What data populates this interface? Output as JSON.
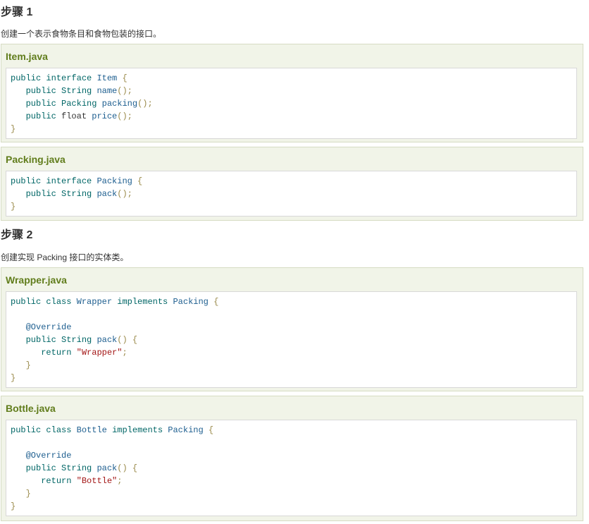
{
  "step1": {
    "title": "步骤 1",
    "desc": "创建一个表示食物条目和食物包装的接口。"
  },
  "step2": {
    "title": "步骤 2",
    "desc": "创建实现 Packing 接口的实体类。"
  },
  "files": [
    {
      "name": "Item.java",
      "lines": [
        [
          [
            "kw",
            "public "
          ],
          [
            "kw",
            "interface "
          ],
          [
            "id",
            "Item "
          ],
          [
            "pu",
            "{"
          ]
        ],
        [
          [
            "pl",
            "   "
          ],
          [
            "kw",
            "public "
          ],
          [
            "kw",
            "String "
          ],
          [
            "id",
            "name"
          ],
          [
            "pu",
            "();"
          ]
        ],
        [
          [
            "pl",
            "   "
          ],
          [
            "kw",
            "public "
          ],
          [
            "kw",
            "Packing "
          ],
          [
            "id",
            "packing"
          ],
          [
            "pu",
            "();"
          ]
        ],
        [
          [
            "pl",
            "   "
          ],
          [
            "kw",
            "public "
          ],
          [
            "pl",
            "float "
          ],
          [
            "id",
            "price"
          ],
          [
            "pu",
            "();"
          ]
        ],
        [
          [
            "pu",
            "}"
          ]
        ]
      ]
    },
    {
      "name": "Packing.java",
      "lines": [
        [
          [
            "kw",
            "public "
          ],
          [
            "kw",
            "interface "
          ],
          [
            "id",
            "Packing "
          ],
          [
            "pu",
            "{"
          ]
        ],
        [
          [
            "pl",
            "   "
          ],
          [
            "kw",
            "public "
          ],
          [
            "kw",
            "String "
          ],
          [
            "id",
            "pack"
          ],
          [
            "pu",
            "();"
          ]
        ],
        [
          [
            "pu",
            "}"
          ]
        ]
      ]
    },
    {
      "name": "Wrapper.java",
      "lines": [
        [
          [
            "kw",
            "public "
          ],
          [
            "kw",
            "class "
          ],
          [
            "id",
            "Wrapper "
          ],
          [
            "kw",
            "implements "
          ],
          [
            "id",
            "Packing "
          ],
          [
            "pu",
            "{"
          ]
        ],
        [
          [
            "pl",
            " "
          ]
        ],
        [
          [
            "pl",
            "   "
          ],
          [
            "an",
            "@Override"
          ]
        ],
        [
          [
            "pl",
            "   "
          ],
          [
            "kw",
            "public "
          ],
          [
            "kw",
            "String "
          ],
          [
            "id",
            "pack"
          ],
          [
            "pu",
            "() {"
          ]
        ],
        [
          [
            "pl",
            "      "
          ],
          [
            "kw",
            "return "
          ],
          [
            "st",
            "\"Wrapper\""
          ],
          [
            "pu",
            ";"
          ]
        ],
        [
          [
            "pl",
            "   "
          ],
          [
            "pu",
            "}"
          ]
        ],
        [
          [
            "pu",
            "}"
          ]
        ]
      ]
    },
    {
      "name": "Bottle.java",
      "lines": [
        [
          [
            "kw",
            "public "
          ],
          [
            "kw",
            "class "
          ],
          [
            "id",
            "Bottle "
          ],
          [
            "kw",
            "implements "
          ],
          [
            "id",
            "Packing "
          ],
          [
            "pu",
            "{"
          ]
        ],
        [
          [
            "pl",
            " "
          ]
        ],
        [
          [
            "pl",
            "   "
          ],
          [
            "an",
            "@Override"
          ]
        ],
        [
          [
            "pl",
            "   "
          ],
          [
            "kw",
            "public "
          ],
          [
            "kw",
            "String "
          ],
          [
            "id",
            "pack"
          ],
          [
            "pu",
            "() {"
          ]
        ],
        [
          [
            "pl",
            "      "
          ],
          [
            "kw",
            "return "
          ],
          [
            "st",
            "\"Bottle\""
          ],
          [
            "pu",
            ";"
          ]
        ],
        [
          [
            "pl",
            "   "
          ],
          [
            "pu",
            "}"
          ]
        ],
        [
          [
            "pu",
            "}"
          ]
        ]
      ]
    }
  ]
}
